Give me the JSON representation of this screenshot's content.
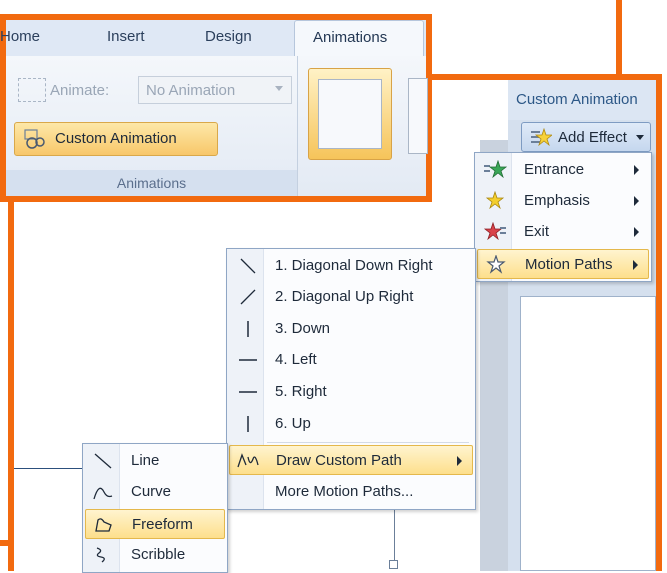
{
  "ribbon": {
    "tabs": [
      "Home",
      "Insert",
      "Design"
    ],
    "active_tab": "Animations",
    "animate_label": "Animate:",
    "animate_value": "No Animation",
    "custom_animation_button": "Custom Animation",
    "group_label": "Animations"
  },
  "task_pane": {
    "title": "Custom Animation",
    "add_effect_label": "Add Effect"
  },
  "effect_menu": {
    "items": [
      {
        "label": "Entrance",
        "icon": "green-star-icon"
      },
      {
        "label": "Emphasis",
        "icon": "yellow-star-icon"
      },
      {
        "label": "Exit",
        "icon": "red-star-icon"
      },
      {
        "label": "Motion Paths",
        "icon": "outline-star-icon"
      }
    ],
    "highlighted": "Motion Paths"
  },
  "motion_paths_menu": {
    "items": [
      {
        "label": "1. Diagonal Down Right",
        "icon": "diagonal-down-line-icon"
      },
      {
        "label": "2. Diagonal Up Right",
        "icon": "diagonal-up-line-icon"
      },
      {
        "label": "3. Down",
        "icon": "vertical-line-icon"
      },
      {
        "label": "4. Left",
        "icon": "horizontal-line-icon"
      },
      {
        "label": "5. Right",
        "icon": "horizontal-line-icon"
      },
      {
        "label": "6. Up",
        "icon": "vertical-line-icon"
      },
      {
        "label": "Draw Custom Path",
        "icon": "custom-path-icon"
      },
      {
        "label": "More Motion Paths...",
        "icon": ""
      }
    ],
    "highlighted": "Draw Custom Path"
  },
  "custom_path_menu": {
    "items": [
      {
        "label": "Line",
        "icon": "line-tool-icon"
      },
      {
        "label": "Curve",
        "icon": "curve-tool-icon"
      },
      {
        "label": "Freeform",
        "icon": "freeform-tool-icon"
      },
      {
        "label": "Scribble",
        "icon": "scribble-tool-icon"
      }
    ],
    "highlighted": "Freeform"
  },
  "colors": {
    "highlight_frame": "#f26a0f",
    "menu_highlight": "#fddf8c",
    "ribbon_bg": "#dfe8f5"
  }
}
